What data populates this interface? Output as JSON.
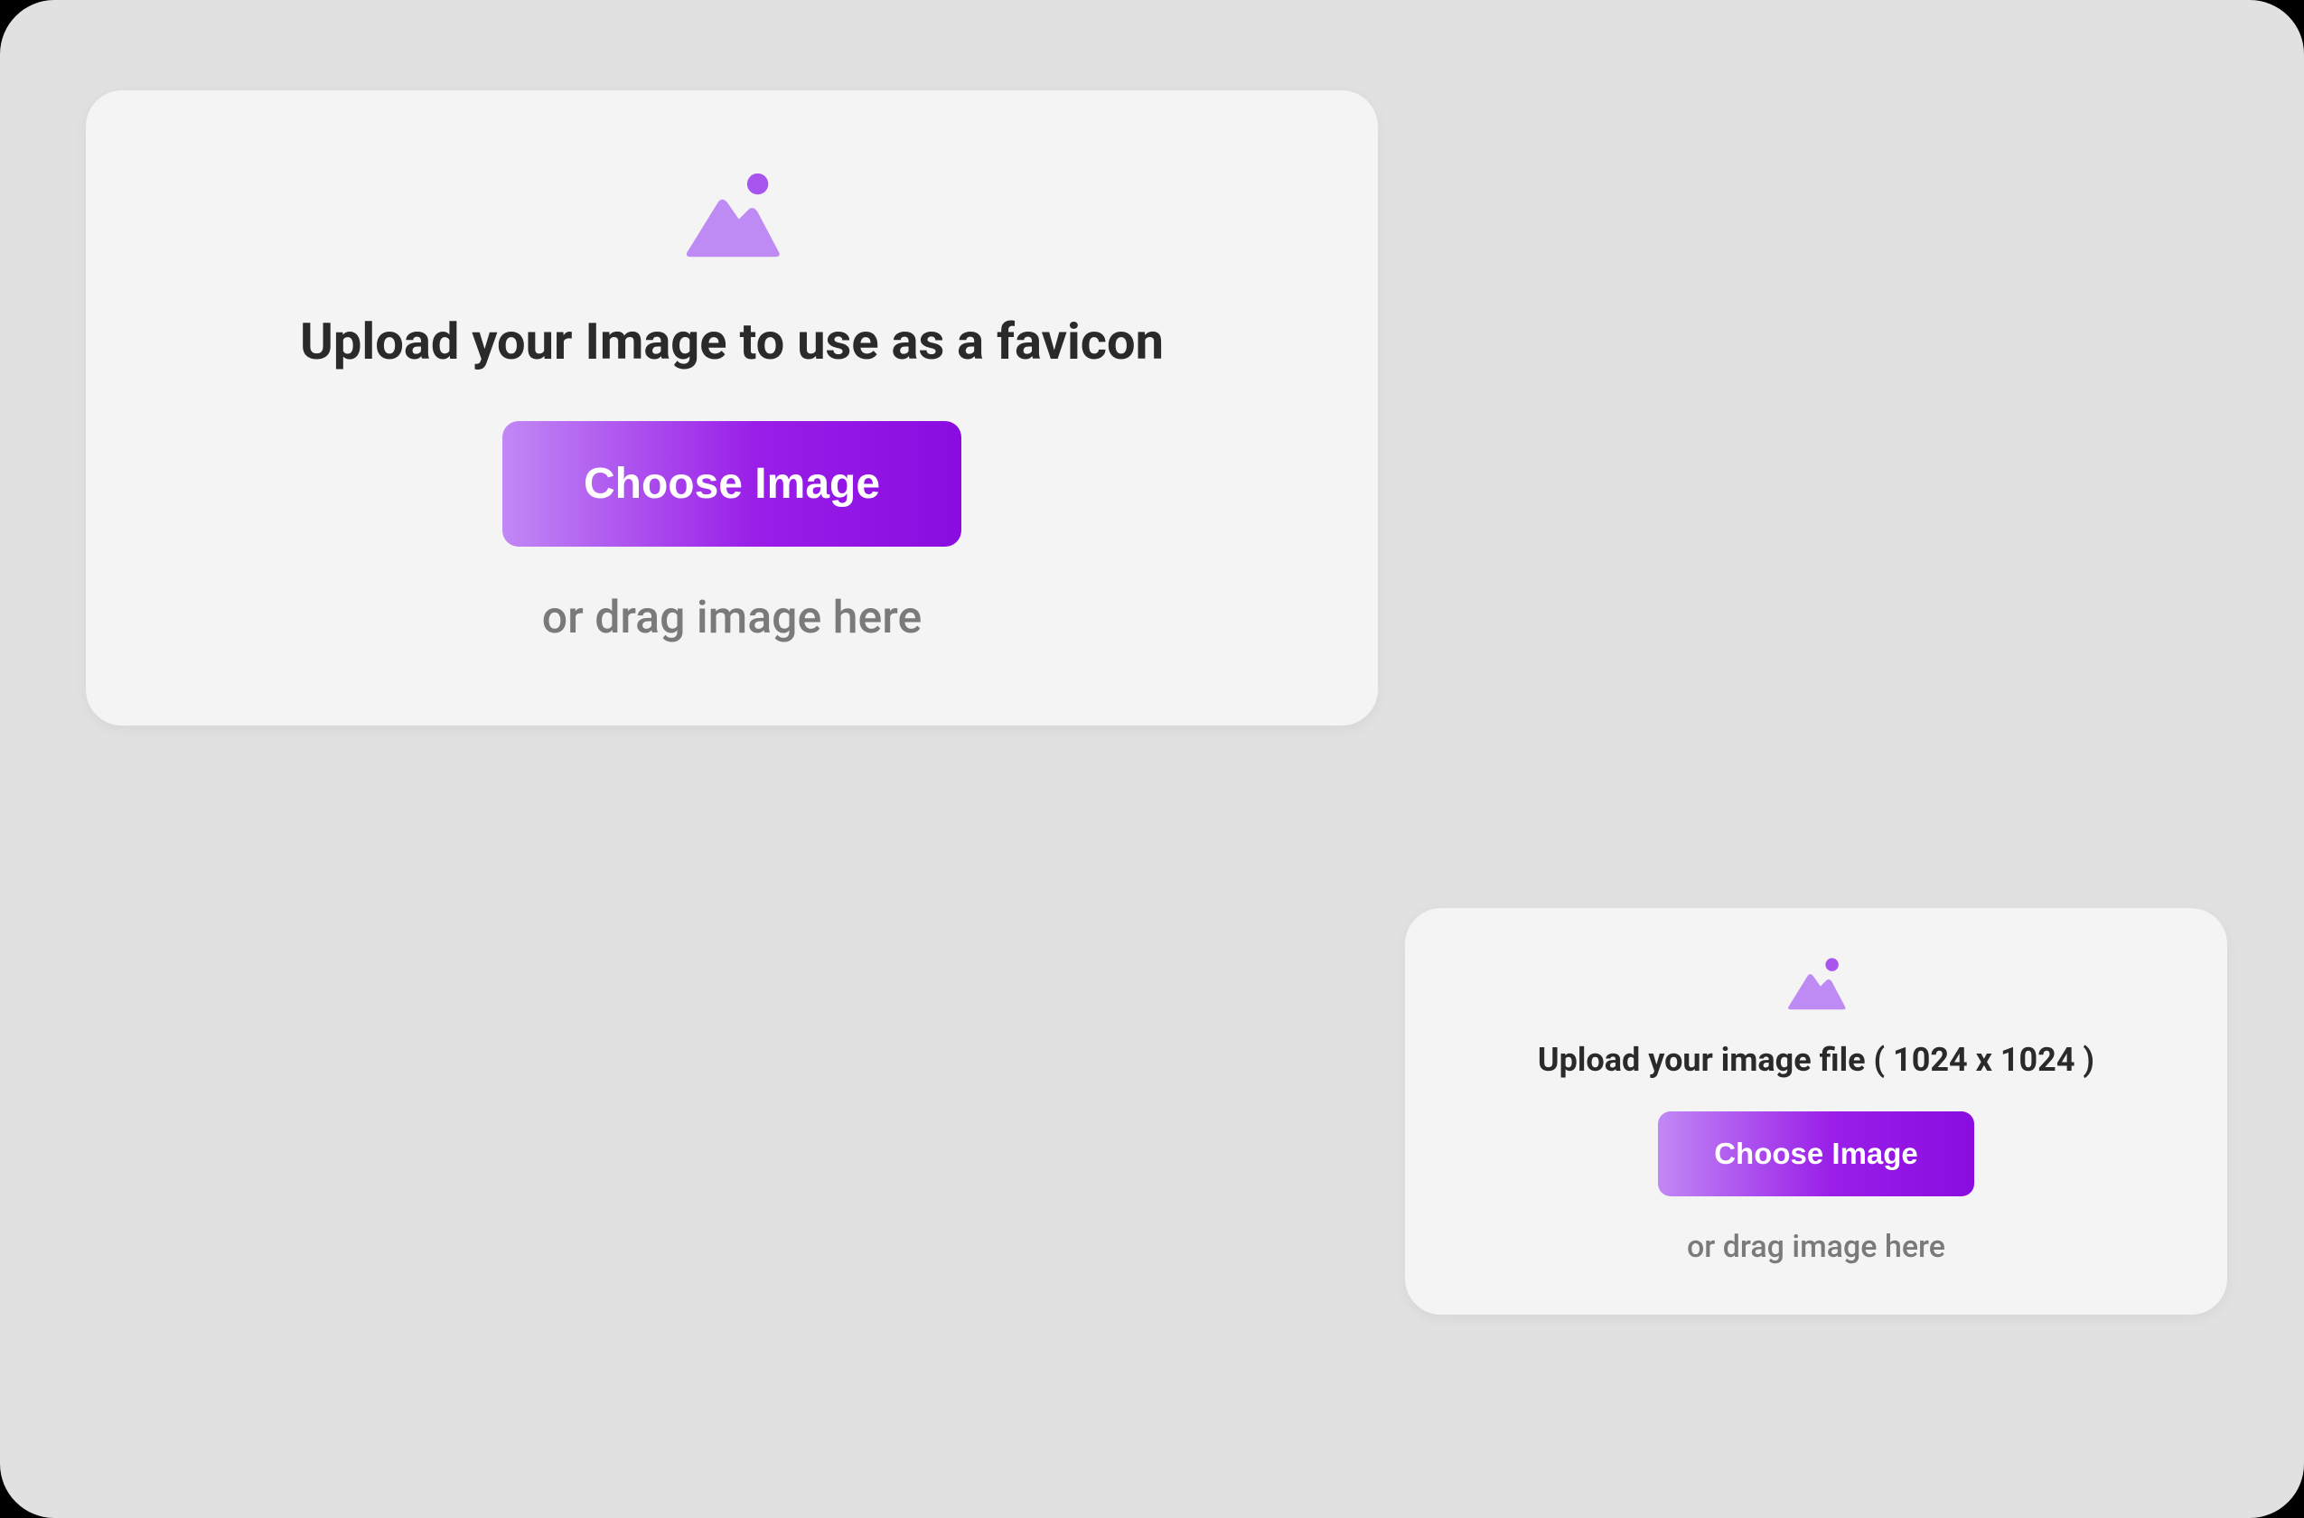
{
  "cards": {
    "favicon": {
      "title": "Upload your Image to use as a favicon",
      "button_label": "Choose Image",
      "drag_hint": "or drag image here"
    },
    "image_file": {
      "title": "Upload your image file ( 1024 x 1024 )",
      "button_label": "Choose Image",
      "drag_hint": "or drag image here"
    }
  },
  "colors": {
    "accent_gradient_start": "#c188f5",
    "accent_gradient_end": "#8a0ce0",
    "icon_light": "#be8af3",
    "icon_dark": "#a855f0"
  }
}
